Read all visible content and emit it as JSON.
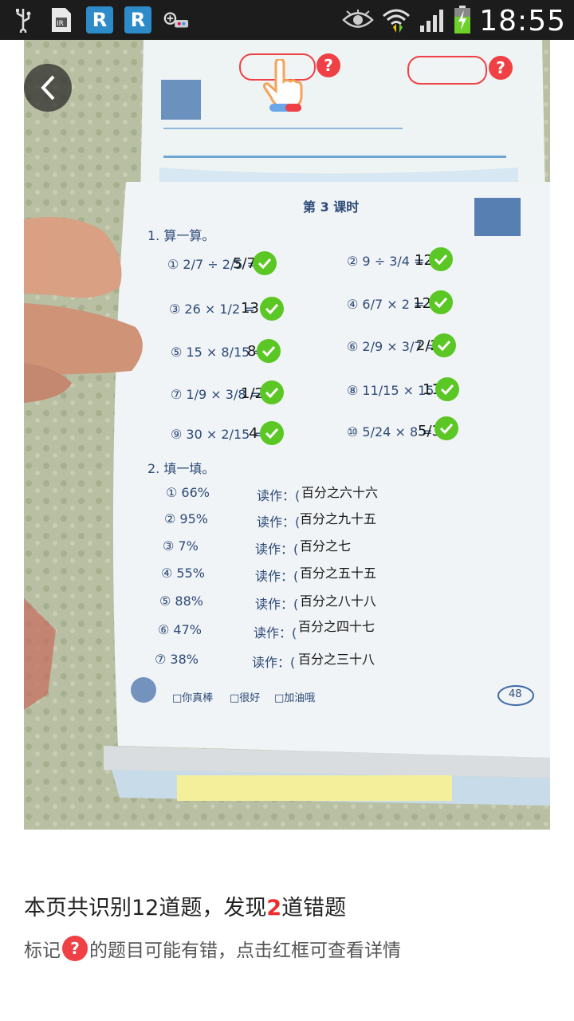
{
  "status_bar": {
    "time": "18:55",
    "app_icon_letter_1": "R",
    "app_icon_letter_2": "R",
    "icons": [
      "usb-icon",
      "doc-icon",
      "app-r-icon",
      "app-r-icon",
      "gamepad-icon",
      "eye-icon",
      "wifi-icon",
      "signal-icon",
      "battery-charging-icon"
    ]
  },
  "photo": {
    "question_mark": "?",
    "worksheet": {
      "lesson_title": "第 3 课时",
      "section1_title": "1. 算一算。",
      "problems": [
        {
          "q": "① 2/7 ÷ 2/5 =",
          "a": "5/7"
        },
        {
          "q": "② 9 ÷ 3/4 =",
          "a": "12"
        },
        {
          "q": "③ 26 × 1/2 =",
          "a": "13"
        },
        {
          "q": "④ 6/7 × 2 =",
          "a": "12/7"
        },
        {
          "q": "⑤ 15 × 8/15 =",
          "a": "8"
        },
        {
          "q": "⑥ 2/9 × 3/7 =",
          "a": "2/21"
        },
        {
          "q": "⑦ 1/9 × 3/8 =",
          "a": "1/24"
        },
        {
          "q": "⑧ 11/15 × 15 =",
          "a": "11"
        },
        {
          "q": "⑨ 30 × 2/15 =",
          "a": "4"
        },
        {
          "q": "⑩ 5/24 × 8 =",
          "a": "5/3"
        }
      ],
      "section2_title": "2. 填一填。",
      "read_as_label": "读作：(",
      "percents": [
        {
          "q": "① 66%",
          "a": "百分之六十六"
        },
        {
          "q": "② 95%",
          "a": "百分之九十五"
        },
        {
          "q": "③ 7%",
          "a": "百分之七"
        },
        {
          "q": "④ 55%",
          "a": "百分之五十五"
        },
        {
          "q": "⑤ 88%",
          "a": "百分之八十八"
        },
        {
          "q": "⑥ 47%",
          "a": "百分之四十七"
        },
        {
          "q": "⑦ 38%",
          "a": "百分之三十八"
        }
      ],
      "footer_checks": [
        "□你真棒",
        "□很好",
        "□加油哦"
      ],
      "page_number": "48"
    }
  },
  "info": {
    "summary_prefix": "本页共识别12道题，发现",
    "error_count": "2",
    "summary_suffix": "道错题",
    "hint_prefix": "标记",
    "hint_q": "?",
    "hint_suffix": "的题目可能有错，点击红框可查看详情"
  },
  "colors": {
    "accent_red": "#ef4145",
    "check_green": "#5ac724",
    "status_bar": "#1c1c1c"
  }
}
